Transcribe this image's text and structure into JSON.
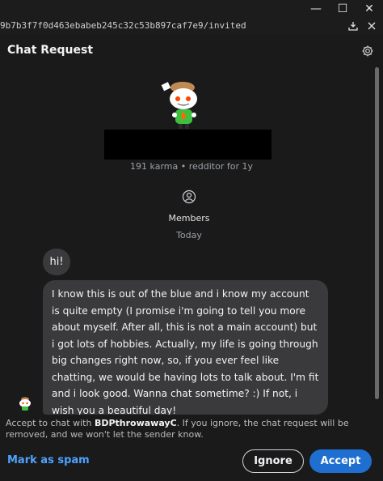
{
  "window": {
    "minimize_glyph": "—",
    "maximize_glyph": "☐",
    "close_glyph": "✕"
  },
  "urlbar": {
    "url": "9b7b3f7f0d463ebabeb245c32c53b897caf7e9/invited",
    "icons": [
      "download-icon",
      "close-icon"
    ]
  },
  "header": {
    "title": "Chat Request",
    "settings_icon": "gear-icon"
  },
  "profile": {
    "stats": "191 karma • redditor for 1y",
    "members_label": "Members",
    "date_label": "Today"
  },
  "messages": [
    {
      "text": "hi!"
    },
    {
      "text": "I know this is out of the blue and i know my account is quite empty (I promise i'm going to tell you more about myself. After all, this is not a main account) but i got lots of hobbies. Actually, my life is going through big changes right now, so, if you ever feel like chatting, we would be having lots to talk about. I'm fit and i look good. Wanna chat sometime? :) If not, i wish you a beautiful day!"
    }
  ],
  "footer": {
    "accept_prefix": "Accept to chat with ",
    "username": "BDPthrowawayC",
    "accept_suffix": ". If you ignore, the chat request will be removed, and we won't let the sender know.",
    "spam_label": "Mark as spam",
    "ignore_label": "Ignore",
    "accept_label": "Accept"
  },
  "colors": {
    "accent": "#1f6fd1",
    "link": "#4fa3ff",
    "bubble": "#3a3a3c",
    "panel": "#1a1a1b"
  }
}
